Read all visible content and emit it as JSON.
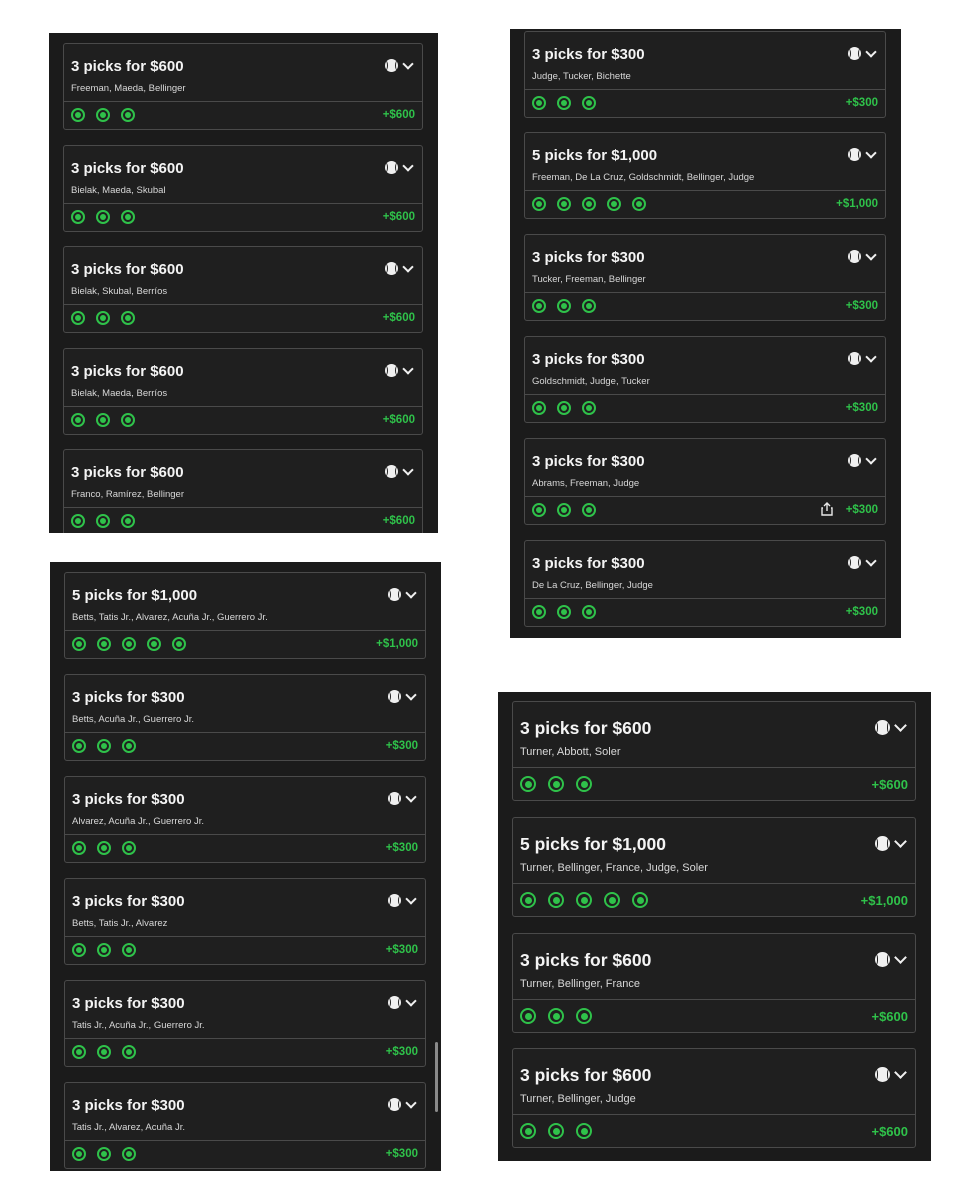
{
  "colors": {
    "background": "#1b1b1b",
    "card_border": "#4a4a4a",
    "win_green": "#2fc24a",
    "text": "#f4f4f4"
  },
  "icons": {
    "sport": "baseball-icon",
    "expand": "chevron-down-icon",
    "pick_status": "check-circle-icon",
    "share": "share-icon"
  },
  "panels": [
    {
      "cards": [
        {
          "title": "3 picks for $600",
          "players": "Freeman, Maeda, Bellinger",
          "picks": 3,
          "payout": "+$600"
        },
        {
          "title": "3 picks for $600",
          "players": "Bielak, Maeda, Skubal",
          "picks": 3,
          "payout": "+$600"
        },
        {
          "title": "3 picks for $600",
          "players": "Bielak, Skubal, Berríos",
          "picks": 3,
          "payout": "+$600"
        },
        {
          "title": "3 picks for $600",
          "players": "Bielak, Maeda, Berríos",
          "picks": 3,
          "payout": "+$600"
        },
        {
          "title": "3 picks for $600",
          "players": "Franco, Ramírez, Bellinger",
          "picks": 3,
          "payout": "+$600"
        }
      ]
    },
    {
      "cards": [
        {
          "title": "3 picks for $300",
          "players": "Judge, Tucker, Bichette",
          "picks": 3,
          "payout": "+$300"
        },
        {
          "title": "5 picks for $1,000",
          "players": "Freeman, De La Cruz, Goldschmidt, Bellinger, Judge",
          "picks": 5,
          "payout": "+$1,000"
        },
        {
          "title": "3 picks for $300",
          "players": "Tucker, Freeman, Bellinger",
          "picks": 3,
          "payout": "+$300"
        },
        {
          "title": "3 picks for $300",
          "players": "Goldschmidt, Judge, Tucker",
          "picks": 3,
          "payout": "+$300"
        },
        {
          "title": "3 picks for $300",
          "players": "Abrams, Freeman, Judge",
          "picks": 3,
          "payout": "+$300",
          "share": true
        },
        {
          "title": "3 picks for $300",
          "players": "De La Cruz, Bellinger, Judge",
          "picks": 3,
          "payout": "+$300"
        }
      ]
    },
    {
      "cards": [
        {
          "title": "5 picks for $1,000",
          "players": "Betts, Tatis Jr., Alvarez, Acuña Jr., Guerrero Jr.",
          "picks": 5,
          "payout": "+$1,000"
        },
        {
          "title": "3 picks for $300",
          "players": "Betts, Acuña Jr., Guerrero Jr.",
          "picks": 3,
          "payout": "+$300"
        },
        {
          "title": "3 picks for $300",
          "players": "Alvarez, Acuña Jr., Guerrero Jr.",
          "picks": 3,
          "payout": "+$300"
        },
        {
          "title": "3 picks for $300",
          "players": "Betts, Tatis Jr., Alvarez",
          "picks": 3,
          "payout": "+$300"
        },
        {
          "title": "3 picks for $300",
          "players": "Tatis Jr., Acuña Jr., Guerrero Jr.",
          "picks": 3,
          "payout": "+$300"
        },
        {
          "title": "3 picks for $300",
          "players": "Tatis Jr., Alvarez, Acuña Jr.",
          "picks": 3,
          "payout": "+$300"
        }
      ]
    },
    {
      "cards": [
        {
          "title": "3 picks for $600",
          "players": "Turner, Abbott, Soler",
          "picks": 3,
          "payout": "+$600"
        },
        {
          "title": "5 picks for $1,000",
          "players": "Turner, Bellinger, France, Judge, Soler",
          "picks": 5,
          "payout": "+$1,000"
        },
        {
          "title": "3 picks for $600",
          "players": "Turner, Bellinger, France",
          "picks": 3,
          "payout": "+$600"
        },
        {
          "title": "3 picks for $600",
          "players": "Turner, Bellinger, Judge",
          "picks": 3,
          "payout": "+$600"
        }
      ]
    }
  ]
}
